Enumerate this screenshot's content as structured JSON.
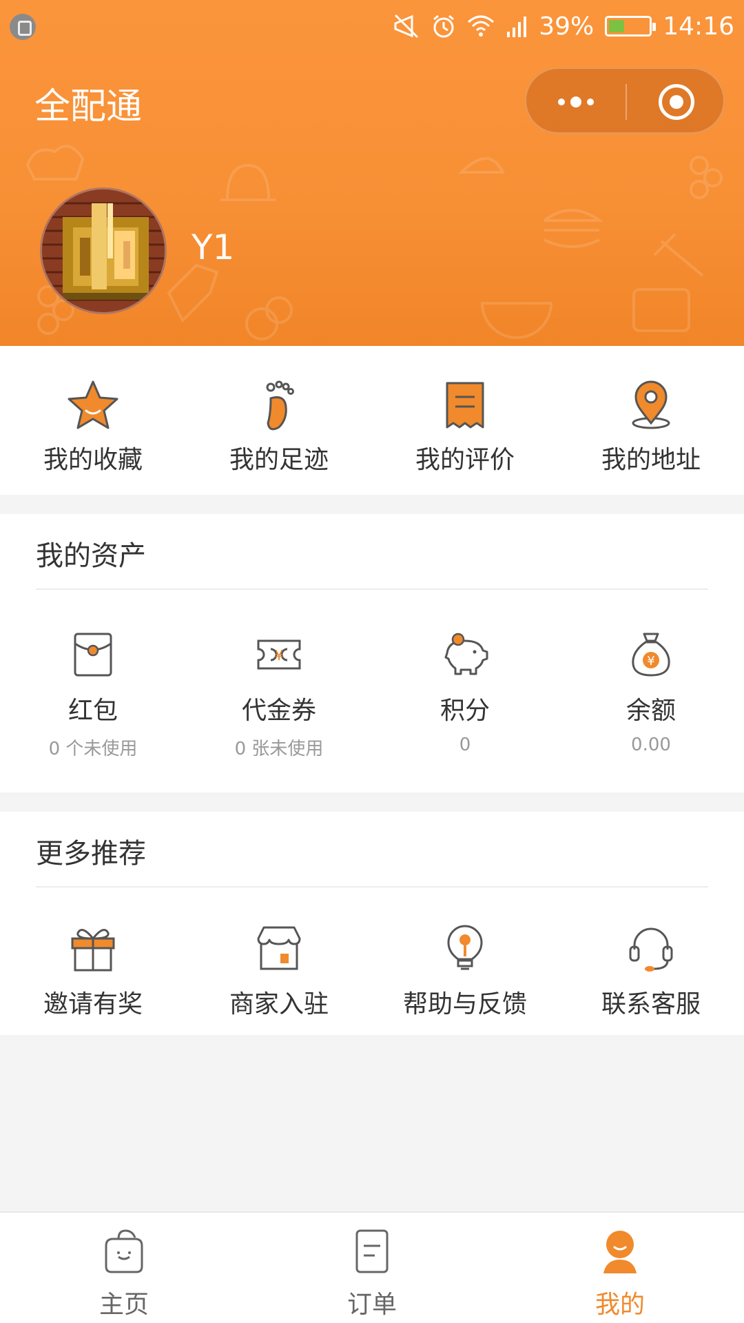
{
  "status_bar": {
    "battery": "39%",
    "time": "14:16",
    "battery_level": 0.39
  },
  "app": {
    "title": "全配通"
  },
  "user": {
    "name": "Y1"
  },
  "quick_links": [
    {
      "label": "我的收藏",
      "icon": "star-icon"
    },
    {
      "label": "我的足迹",
      "icon": "footprint-icon"
    },
    {
      "label": "我的评价",
      "icon": "review-icon"
    },
    {
      "label": "我的地址",
      "icon": "location-pin-icon"
    }
  ],
  "assets": {
    "title": "我的资产",
    "items": [
      {
        "label": "红包",
        "sub": "0 个未使用",
        "icon": "red-envelope-icon"
      },
      {
        "label": "代金券",
        "sub": "0 张未使用",
        "icon": "voucher-icon"
      },
      {
        "label": "积分",
        "sub": "0",
        "icon": "piggy-bank-icon"
      },
      {
        "label": "余额",
        "sub": "0.00",
        "icon": "money-bag-icon"
      }
    ]
  },
  "more": {
    "title": "更多推荐",
    "items": [
      {
        "label": "邀请有奖",
        "icon": "gift-icon"
      },
      {
        "label": "商家入驻",
        "icon": "shop-icon"
      },
      {
        "label": "帮助与反馈",
        "icon": "lightbulb-icon"
      },
      {
        "label": "联系客服",
        "icon": "headset-icon"
      }
    ]
  },
  "tabbar": {
    "items": [
      {
        "label": "主页",
        "icon": "home-bag-icon"
      },
      {
        "label": "订单",
        "icon": "order-icon"
      },
      {
        "label": "我的",
        "icon": "profile-icon"
      }
    ],
    "active": "我的"
  },
  "colors": {
    "accent": "#f08a2c",
    "header": "#f78f35",
    "battery": "#7dc142"
  }
}
